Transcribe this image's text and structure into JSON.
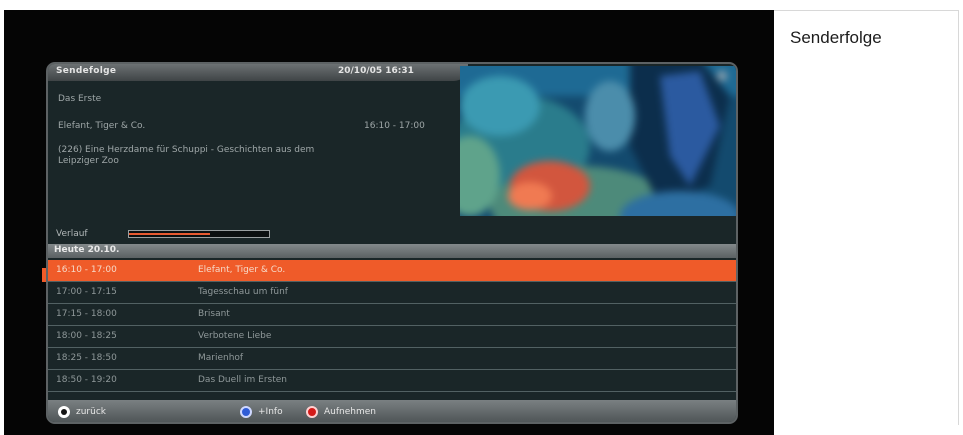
{
  "side_title": "Senderfolge",
  "header": {
    "title": "Sendefolge",
    "datetime": "20/10/05 16:31"
  },
  "current": {
    "channel": "Das Erste",
    "title": "Elefant, Tiger & Co.",
    "time": "16:10 - 17:00",
    "description": "(226) Eine Herzdame für Schuppi - Geschichten aus dem Leipziger Zoo"
  },
  "progress": {
    "label": "Verlauf",
    "percent": 58
  },
  "day_header": "Heute 20.10.",
  "schedule": [
    {
      "time": "16:10 - 17:00",
      "title": "Elefant, Tiger & Co.",
      "selected": true
    },
    {
      "time": "17:00 - 17:15",
      "title": "Tagesschau um fünf",
      "selected": false
    },
    {
      "time": "17:15 - 18:00",
      "title": "Brisant",
      "selected": false
    },
    {
      "time": "18:00 - 18:25",
      "title": "Verbotene Liebe",
      "selected": false
    },
    {
      "time": "18:25 - 18:50",
      "title": "Marienhof",
      "selected": false
    },
    {
      "time": "18:50 - 19:20",
      "title": "Das Duell im Ersten",
      "selected": false
    }
  ],
  "footer": {
    "back": "zurück",
    "info": "+Info",
    "record": "Aufnehmen"
  },
  "colors": {
    "highlight": "#ef5b29",
    "panel": "#1a2628",
    "blue_button": "#2f5cd7",
    "red_button": "#d41a18"
  }
}
